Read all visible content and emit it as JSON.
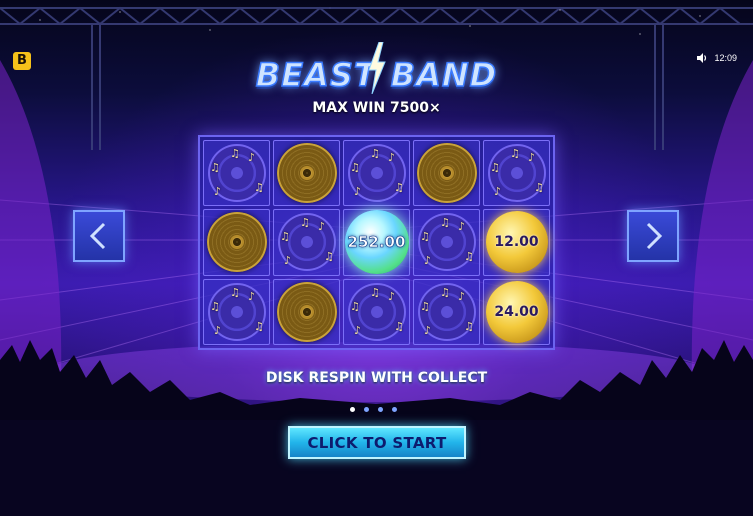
{
  "brand_badge": "B",
  "status": {
    "time": "12:09",
    "sound_icon": "speaker-icon"
  },
  "logo": {
    "left_word": "BEAST",
    "right_word": "BAND"
  },
  "max_win": "MAX WIN 7500×",
  "grid": {
    "rows": [
      [
        {
          "symbol": "speaker"
        },
        {
          "symbol": "gold-disc"
        },
        {
          "symbol": "speaker"
        },
        {
          "symbol": "gold-disc"
        },
        {
          "symbol": "speaker"
        }
      ],
      [
        {
          "symbol": "gold-disc"
        },
        {
          "symbol": "speaker"
        },
        {
          "symbol": "collect-disc",
          "value": "252.00"
        },
        {
          "symbol": "speaker"
        },
        {
          "symbol": "value-disc",
          "value": "12.00"
        }
      ],
      [
        {
          "symbol": "speaker"
        },
        {
          "symbol": "gold-disc"
        },
        {
          "symbol": "speaker"
        },
        {
          "symbol": "speaker"
        },
        {
          "symbol": "value-disc",
          "value": "24.00"
        }
      ]
    ]
  },
  "feature_text": "DISK RESPIN WITH COLLECT",
  "pagination": {
    "total": 4,
    "active_index": 0
  },
  "start_button": "CLICK TO START",
  "colors": {
    "accent": "#5fe6ff",
    "grid_border": "#6c64f0",
    "badge": "#f6c21a"
  }
}
